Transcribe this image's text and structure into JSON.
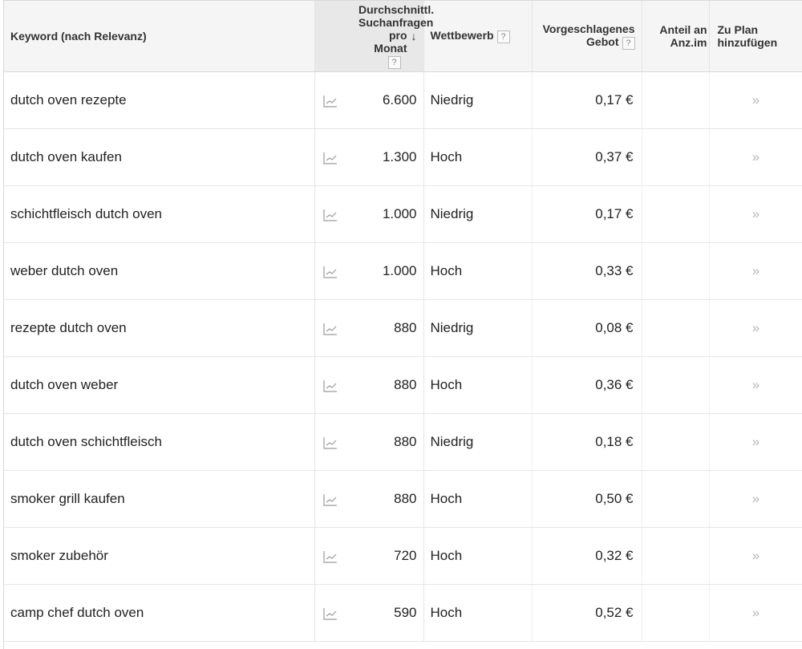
{
  "header": {
    "keyword": "Keyword (nach Relevanz)",
    "volume_line1": "Durchschnittl.",
    "volume_line2": "Suchanfragen",
    "volume_line3": "pro Monat",
    "competition": "Wettbewerb",
    "bid_line1": "Vorgeschlagenes",
    "bid_line2": "Gebot",
    "share_line1": "Anteil an",
    "share_line2": "Anz.im",
    "add_line1": "Zu Plan",
    "add_line2": "hinzufügen",
    "help": "?",
    "sort_arrow": "↓"
  },
  "add_glyph": "»",
  "rows": [
    {
      "keyword": "dutch oven rezepte",
      "volume": "6.600",
      "competition": "Niedrig",
      "bid": "0,17 €"
    },
    {
      "keyword": "dutch oven kaufen",
      "volume": "1.300",
      "competition": "Hoch",
      "bid": "0,37 €"
    },
    {
      "keyword": "schichtfleisch dutch oven",
      "volume": "1.000",
      "competition": "Niedrig",
      "bid": "0,17 €"
    },
    {
      "keyword": "weber dutch oven",
      "volume": "1.000",
      "competition": "Hoch",
      "bid": "0,33 €"
    },
    {
      "keyword": "rezepte dutch oven",
      "volume": "880",
      "competition": "Niedrig",
      "bid": "0,08 €"
    },
    {
      "keyword": "dutch oven weber",
      "volume": "880",
      "competition": "Hoch",
      "bid": "0,36 €"
    },
    {
      "keyword": "dutch oven schichtfleisch",
      "volume": "880",
      "competition": "Niedrig",
      "bid": "0,18 €"
    },
    {
      "keyword": "smoker grill kaufen",
      "volume": "880",
      "competition": "Hoch",
      "bid": "0,50 €"
    },
    {
      "keyword": "smoker zubehör",
      "volume": "720",
      "competition": "Hoch",
      "bid": "0,32 €"
    },
    {
      "keyword": "camp chef dutch oven",
      "volume": "590",
      "competition": "Hoch",
      "bid": "0,52 €"
    }
  ],
  "icons": {
    "trend": "trend-chart-icon",
    "add": "double-chevron-right-icon",
    "help": "help-icon"
  }
}
